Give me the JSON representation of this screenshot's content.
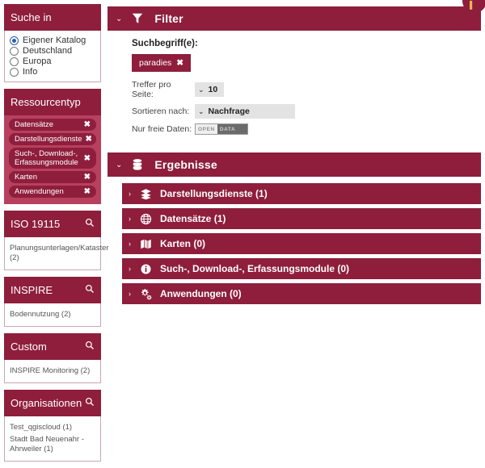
{
  "sidebar": {
    "search_in": {
      "title": "Suche in",
      "options": [
        {
          "label": "Eigener Katalog",
          "selected": true
        },
        {
          "label": "Deutschland",
          "selected": false
        },
        {
          "label": "Europa",
          "selected": false
        },
        {
          "label": "Info",
          "selected": false
        }
      ]
    },
    "resource_type": {
      "title": "Ressourcentyp",
      "pills": [
        {
          "label": "Datensätze",
          "remove": "✖"
        },
        {
          "label": "Darstellungsdienste",
          "remove": "✖"
        },
        {
          "label": "Such-, Download-, Erfassungsmodule",
          "remove": "✖"
        },
        {
          "label": "Karten",
          "remove": "✖"
        },
        {
          "label": "Anwendungen",
          "remove": "✖"
        }
      ]
    },
    "iso": {
      "title": "ISO 19115",
      "search_icon": "search-icon",
      "items": [
        "Planungsunterlagen/Kataster (2)"
      ]
    },
    "inspire": {
      "title": "INSPIRE",
      "search_icon": "search-icon",
      "items": [
        "Bodennutzung (2)"
      ]
    },
    "custom": {
      "title": "Custom",
      "search_icon": "search-icon",
      "items": [
        "INSPIRE Monitoring (2)"
      ]
    },
    "organisations": {
      "title": "Organisationen",
      "search_icon": "search-icon",
      "items": [
        "Test_qgiscloud (1)",
        "Stadt Bad Neuenahr - Ahrweiler (1)"
      ]
    }
  },
  "filter": {
    "caret": "⌄",
    "icon": "funnel-icon",
    "title": "Filter",
    "search_terms_label": "Suchbegriff(e):",
    "tag": {
      "label": "paradies",
      "remove": "✖"
    },
    "hits_per_page": {
      "label": "Treffer pro Seite:",
      "caret": "⌄",
      "value": "10"
    },
    "sort_by": {
      "label": "Sortieren nach:",
      "caret": "⌄",
      "value": "Nachfrage"
    },
    "free_data": {
      "label": "Nur freie Daten:",
      "badge_open": "OPEN",
      "badge_data": "DATA"
    }
  },
  "results": {
    "caret": "⌄",
    "icon": "database-icon",
    "title": "Ergebnisse",
    "rows": [
      {
        "caret": "›",
        "icon": "layers-icon",
        "label": "Darstellungsdienste (1)"
      },
      {
        "caret": "›",
        "icon": "globe-icon",
        "label": "Datensätze (1)"
      },
      {
        "caret": "›",
        "icon": "map-icon",
        "label": "Karten (0)"
      },
      {
        "caret": "›",
        "icon": "info-circle-icon",
        "label": "Such-, Download-, Erfassungsmodule (0)"
      },
      {
        "caret": "›",
        "icon": "gears-icon",
        "label": "Anwendungen (0)"
      }
    ]
  },
  "colors": {
    "brand": "#8e1e3c",
    "brand_light": "#b8405f",
    "select_bg": "#e3e3e3",
    "radio_accent": "#2a5db0"
  }
}
